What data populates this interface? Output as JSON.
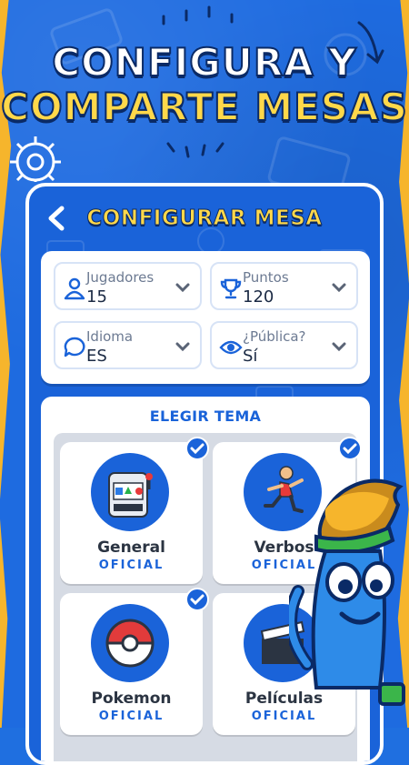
{
  "promo": {
    "line1": "CONFIGURA Y",
    "line2": "COMPARTE MESAS"
  },
  "screen": {
    "title": "CONFIGURAR MESA",
    "back_icon": "chevron-left-icon"
  },
  "settings": [
    {
      "label": "Jugadores",
      "value": "15",
      "icon": "person-icon"
    },
    {
      "label": "Puntos",
      "value": "120",
      "icon": "trophy-icon"
    },
    {
      "label": "Idioma",
      "value": "ES",
      "icon": "chat-bubble-icon"
    },
    {
      "label": "¿Pública?",
      "value": "Sí",
      "icon": "eye-icon"
    }
  ],
  "themes": {
    "heading": "ELEGIR TEMA",
    "items": [
      {
        "name": "General",
        "badge": "OFICIAL",
        "selected": true,
        "icon": "slot-machine-icon"
      },
      {
        "name": "Verbos",
        "badge": "OFICIAL",
        "selected": true,
        "icon": "running-person-icon"
      },
      {
        "name": "Pokemon",
        "badge": "OFICIAL",
        "selected": true,
        "icon": "pokeball-icon"
      },
      {
        "name": "Películas",
        "badge": "OFICIAL",
        "selected": false,
        "icon": "clapperboard-icon"
      }
    ]
  },
  "colors": {
    "primary_blue": "#1a63d9",
    "accent_yellow": "#ffd84a",
    "edge_orange": "#f6b52c"
  }
}
